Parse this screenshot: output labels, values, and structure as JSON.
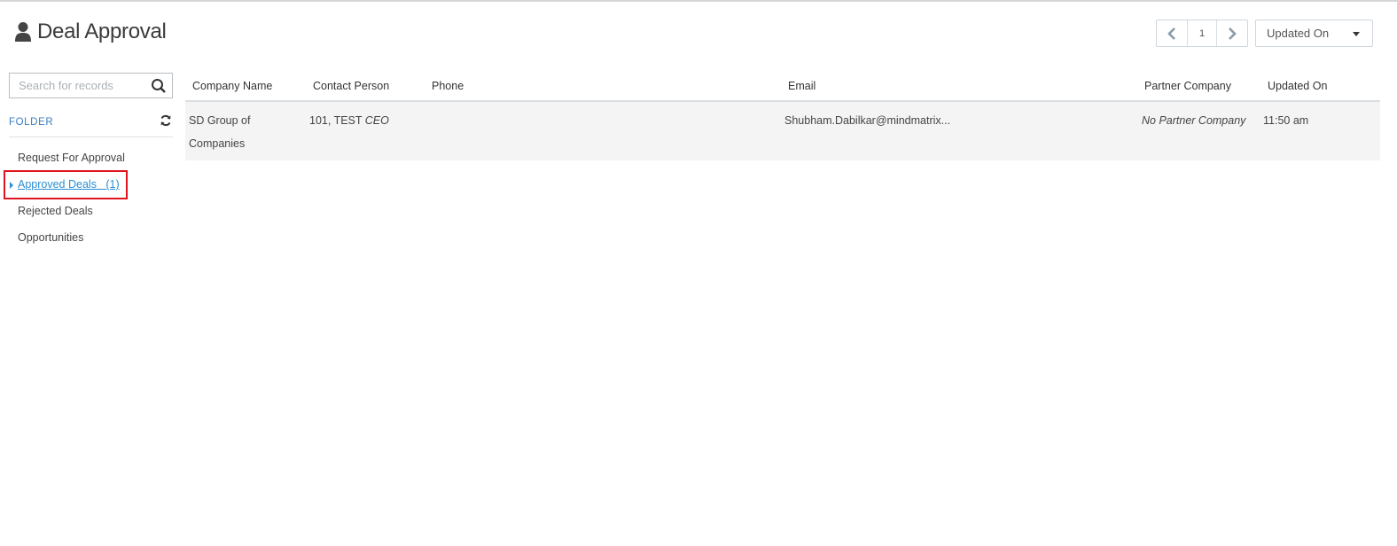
{
  "header": {
    "title": "Deal Approval",
    "pager_page": "1",
    "sort_selected": "Updated On"
  },
  "sidebar": {
    "search_placeholder": "Search for records",
    "folder_label": "FOLDER",
    "items": [
      {
        "label": "Request For Approval"
      },
      {
        "label": "Approved Deals   (1)"
      },
      {
        "label": "Rejected Deals"
      },
      {
        "label": "Opportunities"
      }
    ]
  },
  "table": {
    "columns": {
      "company": "Company Name",
      "contact": "Contact Person",
      "phone": "Phone",
      "email": "Email",
      "partner": "Partner Company",
      "updated": "Updated On"
    },
    "rows": [
      {
        "company_line1": "SD Group of",
        "company_line2": "Companies",
        "contact_name": "101, TEST",
        "contact_title": "CEO",
        "phone": "",
        "email": "Shubham.Dabilkar@mindmatrix...",
        "partner": "No Partner Company",
        "updated": "11:50 am"
      }
    ]
  },
  "colors": {
    "accent": "#2a8fd4",
    "folder_label": "#3a7dbd",
    "highlight": "#e0141e",
    "row_bg": "#f4f4f4"
  },
  "icons": [
    "user-icon",
    "chevron-left-icon",
    "chevron-right-icon",
    "caret-down-icon",
    "search-icon",
    "refresh-icon",
    "arrow-icon"
  ]
}
